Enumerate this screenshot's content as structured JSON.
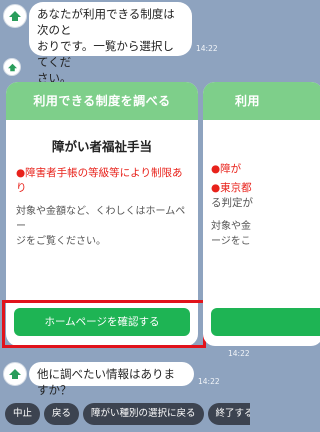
{
  "messages": {
    "first": {
      "text_line1": "あなたが利用できる制度は次のと",
      "text_line2": "おりです。一覧から選択してくだ",
      "text_line3": "さい。",
      "time": "14:22"
    },
    "last": {
      "text": "他に調べたい情報はありますか？",
      "time": "14:22"
    },
    "carousel_time": "14:22",
    "avatar_label": "障がい"
  },
  "carousel": {
    "card1": {
      "header": "利用できる制度を調べる",
      "title": "障がい者福祉手当",
      "condition": "●障害者手帳の等級等により制限あり",
      "desc_line1": "対象や金額など、くわしくはホームペー",
      "desc_line2": "ジをご覧ください。",
      "button": "ホームページを確認する"
    },
    "card2": {
      "header": "利用",
      "condition1": "●障が",
      "condition2": "●東京都",
      "condition2b": "る判定が",
      "desc_line1": "対象や金",
      "desc_line2": "ージをこ"
    }
  },
  "quick_replies": [
    "中止",
    "戻る",
    "障がい種別の選択に戻る",
    "終了する"
  ],
  "colors": {
    "background": "#8ea3bf",
    "card_header": "#7ecf8a",
    "button_green": "#1eb454",
    "alert_red": "#e8221b",
    "highlight_border": "#e1131b",
    "quick_reply_bg": "#3c4350"
  }
}
